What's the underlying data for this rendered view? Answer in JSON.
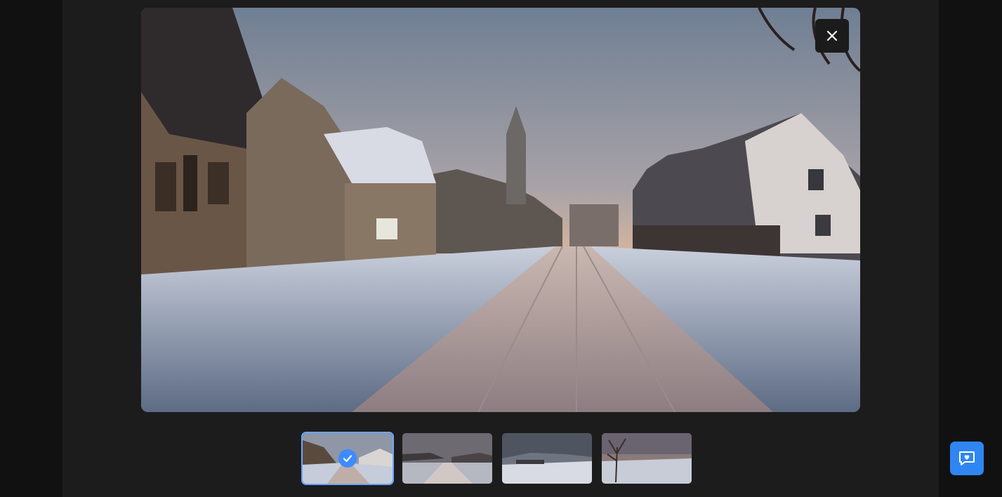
{
  "viewer": {
    "main_image": {
      "alt": "",
      "scene": "snowy-village-street-sunset"
    },
    "close_icon": "close-icon",
    "thumbnails": [
      {
        "scene": "snowy-village-street-houses",
        "selected": true
      },
      {
        "scene": "snowy-road-village-dusk",
        "selected": false
      },
      {
        "scene": "snowy-hills-village",
        "selected": false
      },
      {
        "scene": "bare-tree-snowy-town-sunset",
        "selected": false
      }
    ],
    "selected_icon": "check-icon"
  },
  "support": {
    "icon": "chat-heart-icon"
  },
  "colors": {
    "accent": "#3d8bff",
    "selected_outline": "#6aa7ff",
    "chat_button": "#2f86f3",
    "modal_bg": "#1c1c1c"
  }
}
